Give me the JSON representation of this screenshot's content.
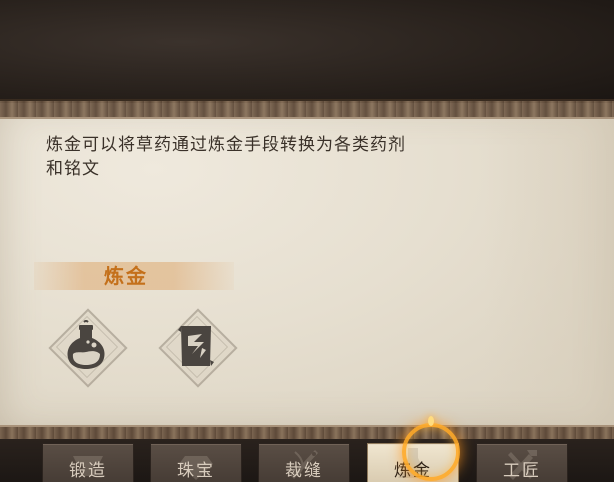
{
  "panel": {
    "description_line1": "炼金可以将草药通过炼金手段转换为各类药剂",
    "description_line2": "和铭文"
  },
  "section": {
    "title": "炼金"
  },
  "recipes": [
    {
      "icon": "potion-flask-icon"
    },
    {
      "icon": "scroll-inscription-icon"
    }
  ],
  "tabs": [
    {
      "label": "锻造",
      "icon": "anvil-icon",
      "active": false
    },
    {
      "label": "珠宝",
      "icon": "gem-icon",
      "active": false
    },
    {
      "label": "裁缝",
      "icon": "needle-icon",
      "active": false
    },
    {
      "label": "炼金",
      "icon": "flask-icon",
      "active": true
    },
    {
      "label": "工匠",
      "icon": "tools-icon",
      "active": false
    }
  ],
  "colors": {
    "accent_orange": "#c4701a",
    "text_dark": "#3a3129",
    "parchment": "#e6dfd0",
    "glow": "#ffaa28"
  }
}
